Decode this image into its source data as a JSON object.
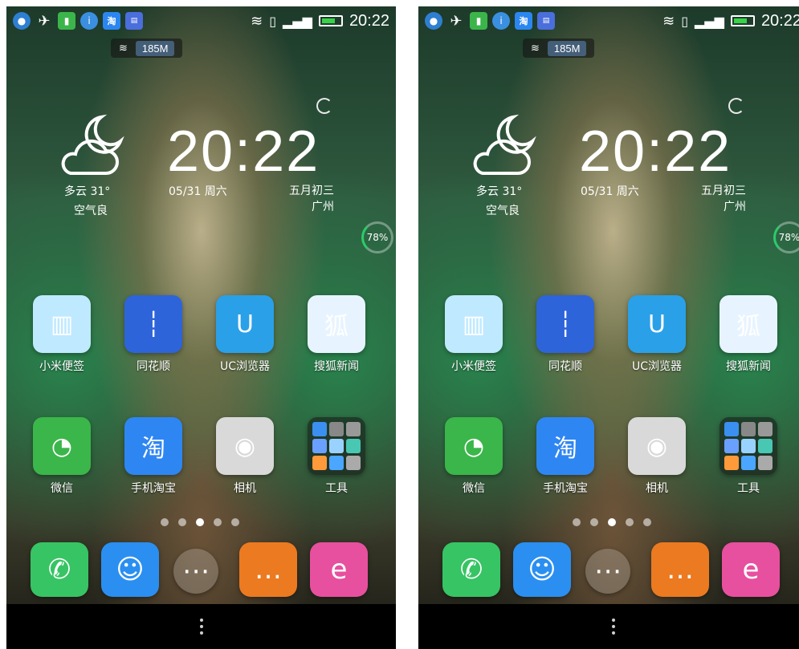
{
  "status": {
    "time": "20:22",
    "network_speed": "185M"
  },
  "weather": {
    "condition_temp": "多云 31°",
    "air_quality": "空气良"
  },
  "clock": {
    "time": "20:22",
    "date": "05/31  周六",
    "lunar_date": "五月初三",
    "city": "广州"
  },
  "widget": {
    "battery_percent": "78%"
  },
  "apps": [
    {
      "label": "小米便签",
      "icon_name": "note-icon"
    },
    {
      "label": "同花顺",
      "icon_name": "stock-chart-icon"
    },
    {
      "label": "UC浏览器",
      "icon_name": "uc-squirrel-icon"
    },
    {
      "label": "搜狐新闻",
      "icon_name": "sohu-icon"
    },
    {
      "label": "微信",
      "icon_name": "wechat-icon"
    },
    {
      "label": "手机淘宝",
      "icon_name": "taobao-icon"
    },
    {
      "label": "相机",
      "icon_name": "camera-icon"
    },
    {
      "label": "工具",
      "icon_name": "folder-tools-icon"
    }
  ],
  "dock": [
    {
      "icon_name": "phone-icon"
    },
    {
      "icon_name": "contacts-icon"
    },
    {
      "icon_name": "app-drawer-icon"
    },
    {
      "icon_name": "message-icon"
    },
    {
      "icon_name": "browser-icon"
    }
  ],
  "page_indicator": {
    "count": 5,
    "active_index": 2
  },
  "colors": {
    "battery_green": "#39d24a",
    "wechat_green": "#3bb64a",
    "taobao_blue": "#2e86f2"
  }
}
